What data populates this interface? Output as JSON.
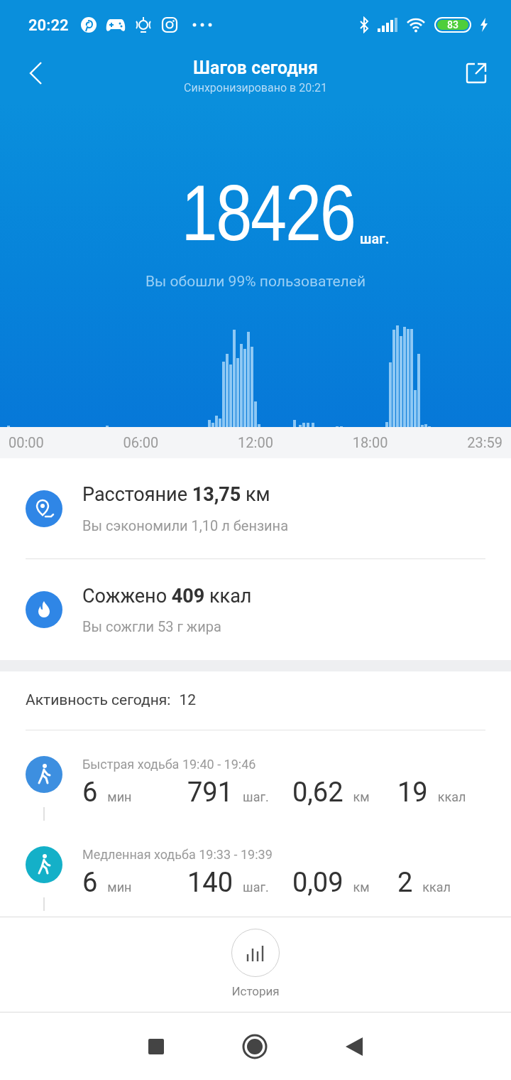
{
  "status_bar": {
    "time": "20:22",
    "battery": "83"
  },
  "header": {
    "title": "Шагов сегодня",
    "subtitle": "Синхронизировано в 20:21"
  },
  "summary": {
    "steps": "18426",
    "unit": "шаг.",
    "caption": "Вы обошли 99% пользователей"
  },
  "chart_axis": [
    "00:00",
    "06:00",
    "12:00",
    "18:00",
    "23:59"
  ],
  "metrics": [
    {
      "kind": "distance",
      "title": "Расстояние **13,75** км",
      "note": "Вы сэкономили 1,10 л бензина"
    },
    {
      "kind": "calories",
      "title": "Сожжено **409** ккал",
      "note": "Вы сожгли 53 г жира"
    }
  ],
  "activity": {
    "label": "Активность сегодня:",
    "count": "12",
    "items": [
      {
        "title": "Быстрая ходьба 19:40 - 19:46",
        "color": "#3d8fe0",
        "stats": [
          {
            "value": "6",
            "unit": "мин"
          },
          {
            "value": "791",
            "unit": "шаг."
          },
          {
            "value": "0,62",
            "unit": "км"
          },
          {
            "value": "19",
            "unit": "ккал"
          }
        ]
      },
      {
        "title": "Медленная ходьба 19:33 - 19:39",
        "color": "#14b0c8",
        "stats": [
          {
            "value": "6",
            "unit": "мин"
          },
          {
            "value": "140",
            "unit": "шаг."
          },
          {
            "value": "0,09",
            "unit": "км"
          },
          {
            "value": "2",
            "unit": "ккал"
          }
        ]
      }
    ]
  },
  "history_button": {
    "label": "История"
  }
}
